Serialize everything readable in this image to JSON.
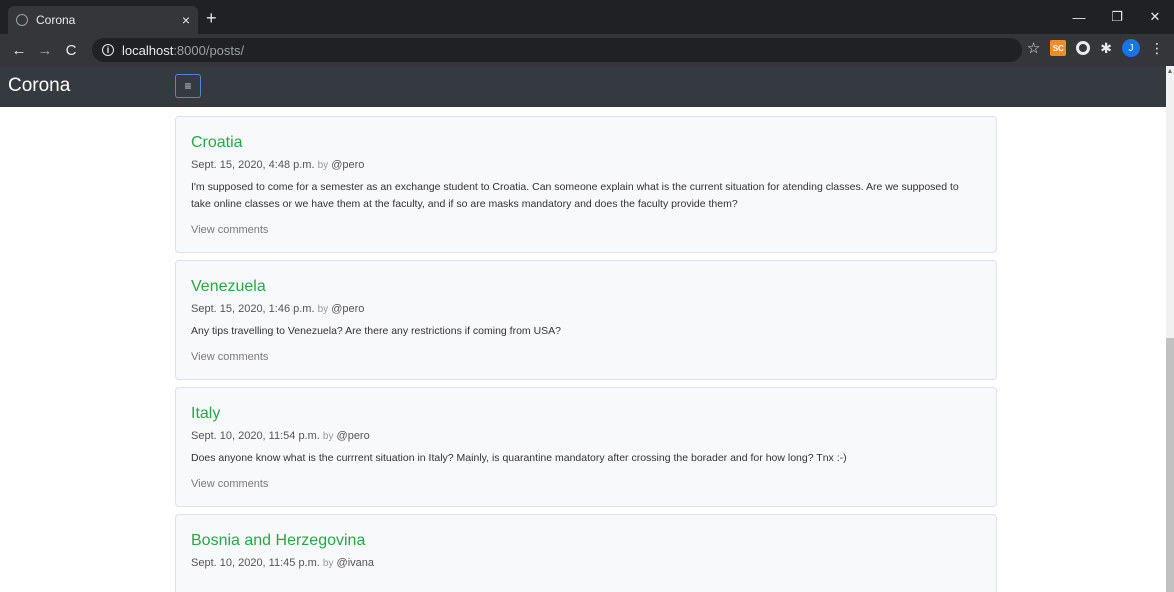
{
  "browser": {
    "tab_title": "Corona",
    "tab_close": "×",
    "new_tab": "+",
    "url_host": "localhost",
    "url_rest": ":8000/posts/",
    "controls": {
      "minimize": "—",
      "restore": "❐",
      "close": "✕"
    },
    "nav": {
      "back": "←",
      "forward": "→",
      "reload": "C"
    },
    "extensions": {
      "sc_label": "SC",
      "avatar_letter": "J"
    }
  },
  "navbar": {
    "brand": "Corona",
    "toggler_glyph": "≡"
  },
  "posts": [
    {
      "title": "Croatia",
      "date": "Sept. 15, 2020, 4:48 p.m.",
      "by": "by",
      "author": "@pero",
      "body": "I'm supposed to come for a semester as an exchange student to Croatia. Can someone explain what is the current situation for atending classes. Are we supposed to take online classes or we have them at the faculty, and if so are masks mandatory and does the faculty provide them?",
      "link": "View comments"
    },
    {
      "title": "Venezuela",
      "date": "Sept. 15, 2020, 1:46 p.m.",
      "by": "by",
      "author": "@pero",
      "body": "Any tips travelling to Venezuela? Are there any restrictions if coming from USA?",
      "link": "View comments"
    },
    {
      "title": "Italy",
      "date": "Sept. 10, 2020, 11:54 p.m.",
      "by": "by",
      "author": "@pero",
      "body": "Does anyone know what is the currrent situation in Italy? Mainly, is quarantine mandatory after crossing the borader and for how long? Tnx :-)",
      "link": "View comments"
    },
    {
      "title": "Bosnia and Herzegovina",
      "date": "Sept. 10, 2020, 11:45 p.m.",
      "by": "by",
      "author": "@ivana",
      "body": "",
      "link": ""
    }
  ]
}
